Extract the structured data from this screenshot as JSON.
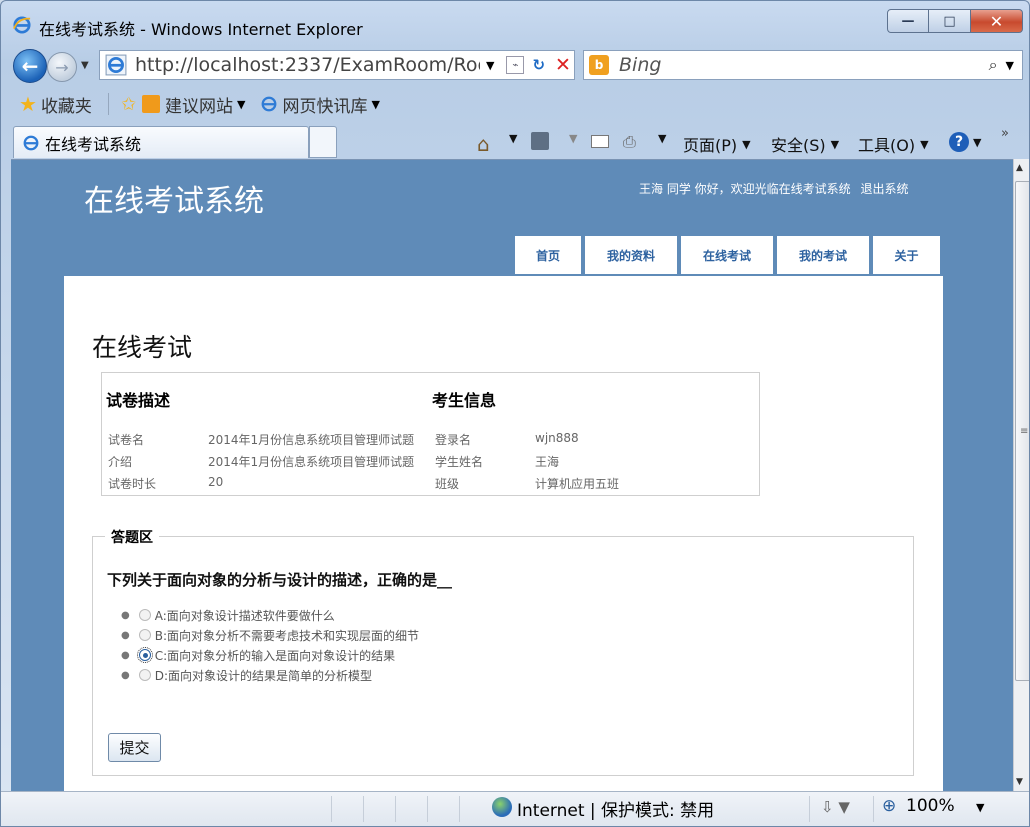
{
  "window": {
    "title": "在线考试系统 - Windows Internet Explorer",
    "minimize": "—",
    "maximize": "□",
    "close": "✕"
  },
  "address_bar": {
    "url": "http://localhost:2337/ExamRoom/Roo",
    "search_placeholder": "Bing"
  },
  "favorites_bar": {
    "favorites_label": "收藏夹",
    "suggested_sites": "建议网站",
    "web_slice_gallery": "网页快讯库"
  },
  "tab": {
    "title": "在线考试系统"
  },
  "command_bar": {
    "page_menu": "页面(P)",
    "safety_menu": "安全(S)",
    "tools_menu": "工具(O)"
  },
  "site": {
    "title": "在线考试系统",
    "greeting": "王海 同学 你好，欢迎光临在线考试系统",
    "logout": "退出系统",
    "nav": [
      "首页",
      "我的资料",
      "在线考试",
      "我的考试",
      "关于"
    ]
  },
  "page": {
    "title": "在线考试",
    "paper_heading": "试卷描述",
    "candidate_heading": "考生信息",
    "paper_rows": [
      {
        "label": "试卷名",
        "value": "2014年1月份信息系统项目管理师试题"
      },
      {
        "label": "介绍",
        "value": "2014年1月份信息系统项目管理师试题"
      },
      {
        "label": "试卷时长",
        "value": "20"
      }
    ],
    "candidate_rows": [
      {
        "label": "登录名",
        "value": "wjn888"
      },
      {
        "label": "学生姓名",
        "value": "王海"
      },
      {
        "label": "班级",
        "value": "计算机应用五班"
      }
    ]
  },
  "answer_area": {
    "legend": "答题区",
    "question": "下列关于面向对象的分析与设计的描述，正确的是__",
    "options": [
      "A:面向对象设计描述软件要做什么",
      "B:面向对象分析不需要考虑技术和实现层面的细节",
      "C:面向对象分析的输入是面向对象设计的结果",
      "D:面向对象设计的结果是简单的分析模型"
    ],
    "selected_option": "C",
    "submit_label": "提交"
  },
  "status_bar": {
    "zone": "Internet | 保护模式: 禁用",
    "zoom": "100%"
  }
}
